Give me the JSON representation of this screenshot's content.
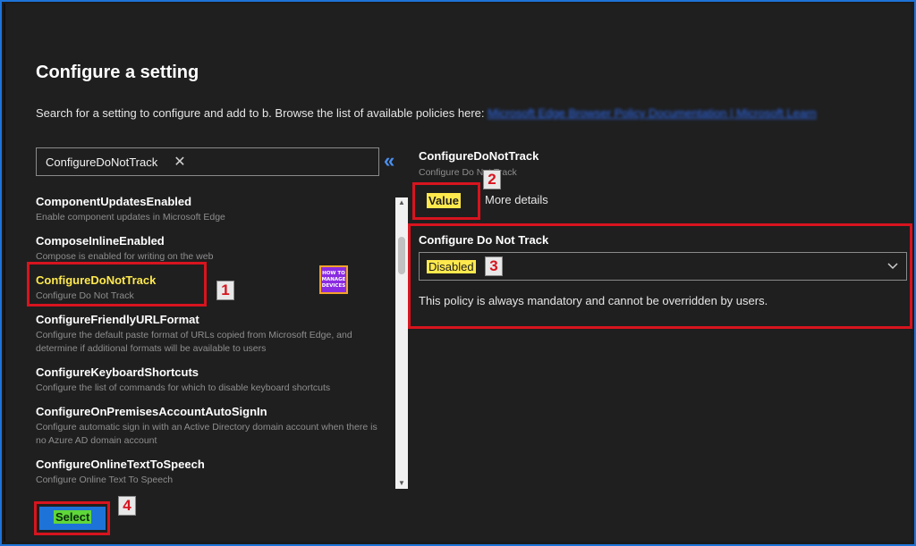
{
  "header": {
    "title": "Configure a setting",
    "description": "Search for a setting to configure and add to b. Browse the list of available policies here: ",
    "link_text": "Microsoft Edge Browser Policy Documentation | Microsoft Learn"
  },
  "search": {
    "value": "ConfigureDoNotTrack",
    "clear_icon": "close-icon"
  },
  "collapse_icon": "double-chevron-left-icon",
  "settings_list": [
    {
      "name": "ComponentUpdatesEnabled",
      "description": "Enable component updates in Microsoft Edge"
    },
    {
      "name": "ComposeInlineEnabled",
      "description": "Compose is enabled for writing on the web"
    },
    {
      "name": "ConfigureDoNotTrack",
      "description": "Configure Do Not Track",
      "selected": true
    },
    {
      "name": "ConfigureFriendlyURLFormat",
      "description": "Configure the default paste format of URLs copied from Microsoft Edge, and determine if additional formats will be available to users"
    },
    {
      "name": "ConfigureKeyboardShortcuts",
      "description": "Configure the list of commands for which to disable keyboard shortcuts"
    },
    {
      "name": "ConfigureOnPremisesAccountAutoSignIn",
      "description": "Configure automatic sign in with an Active Directory domain account when there is no Azure AD domain account"
    },
    {
      "name": "ConfigureOnlineTextToSpeech",
      "description": "Configure Online Text To Speech"
    }
  ],
  "detail": {
    "title": "ConfigureDoNotTrack",
    "subtitle": "Configure Do Not Track",
    "tabs": {
      "value": "Value",
      "more_details": "More details"
    },
    "field_label": "Configure Do Not Track",
    "dropdown_value": "Disabled",
    "policy_note": "This policy is always mandatory and cannot be overridden by users."
  },
  "footer": {
    "select_label": "Select"
  },
  "annotations": [
    "1",
    "2",
    "3",
    "4"
  ],
  "logo": {
    "line1": "HOW TO",
    "line2": "MANAGE",
    "line3": "DEVICES"
  },
  "colors": {
    "background": "#1f1f1f",
    "highlight_yellow": "#ffe94d",
    "annotation_red": "#d7141e",
    "link_blue": "#2d6cf6",
    "button_blue": "#1e73d8",
    "select_green": "#5fd73a"
  }
}
